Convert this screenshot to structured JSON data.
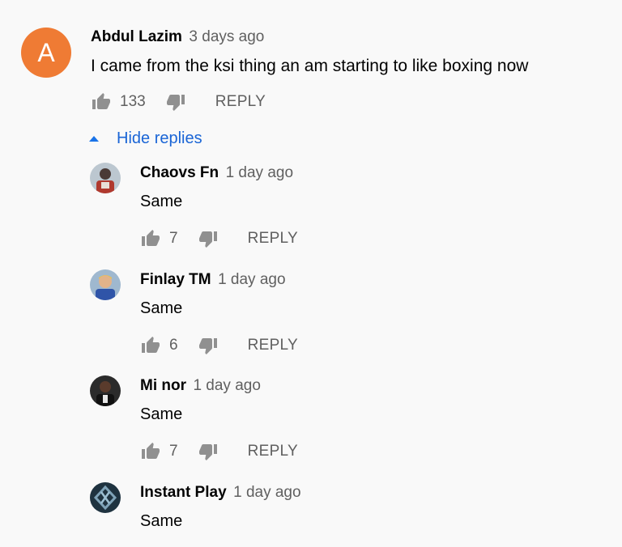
{
  "comment": {
    "avatar_letter": "A",
    "avatar_color": "#ef7b34",
    "author": "Abdul Lazim",
    "time": "3 days ago",
    "text": "I came from the ksi thing an am starting to like boxing now",
    "likes": "133",
    "reply_label": "REPLY",
    "like_icon": "thumbs-up-icon",
    "dislike_icon": "thumbs-down-icon"
  },
  "hide_replies": {
    "label": "Hide replies",
    "icon": "caret-up-icon",
    "color": "#1a65d6"
  },
  "replies": [
    {
      "author": "Chaovs Fn",
      "time": "1 day ago",
      "text": "Same",
      "likes": "7",
      "reply_label": "REPLY"
    },
    {
      "author": "Finlay TM",
      "time": "1 day ago",
      "text": "Same",
      "likes": "6",
      "reply_label": "REPLY"
    },
    {
      "author": "Mi nor",
      "time": "1 day ago",
      "text": "Same",
      "likes": "7",
      "reply_label": "REPLY"
    },
    {
      "author": "Instant Play",
      "time": "1 day ago",
      "text": "Same"
    }
  ]
}
